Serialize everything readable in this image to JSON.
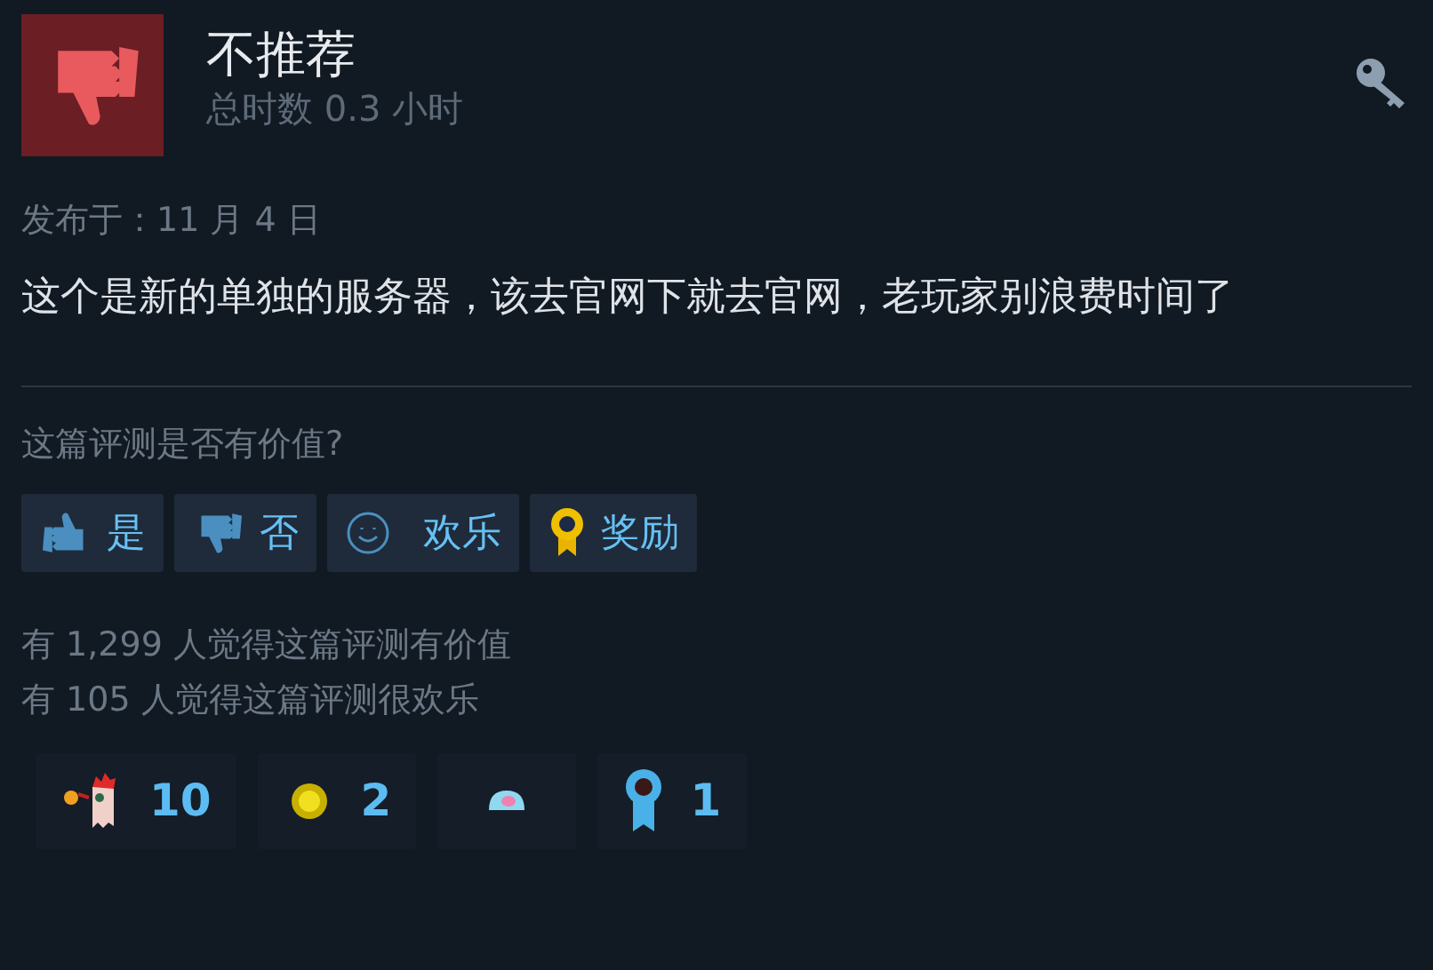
{
  "review": {
    "verdict": "不推荐",
    "recommended": false,
    "playtime": "总时数 0.3 小时",
    "posted": "发布于：11 月 4 日",
    "body": "这个是新的单独的服务器，该去官网下就去官网，老玩家别浪费时间了"
  },
  "helpful": {
    "question": "这篇评测是否有价值?",
    "buttons": [
      {
        "kind": "yes",
        "label": "是"
      },
      {
        "kind": "no",
        "label": "否"
      },
      {
        "kind": "funny",
        "label": "欢乐"
      },
      {
        "kind": "award",
        "label": "奖励"
      }
    ]
  },
  "stats": [
    "有 1,299 人觉得这篇评测有价值",
    "有 105 人觉得这篇评测很欢乐"
  ],
  "awards": [
    {
      "kind": "rooster",
      "count": "10"
    },
    {
      "kind": "coin",
      "count": "2"
    },
    {
      "kind": "blob"
    },
    {
      "kind": "ribbon",
      "count": "1"
    }
  ]
}
